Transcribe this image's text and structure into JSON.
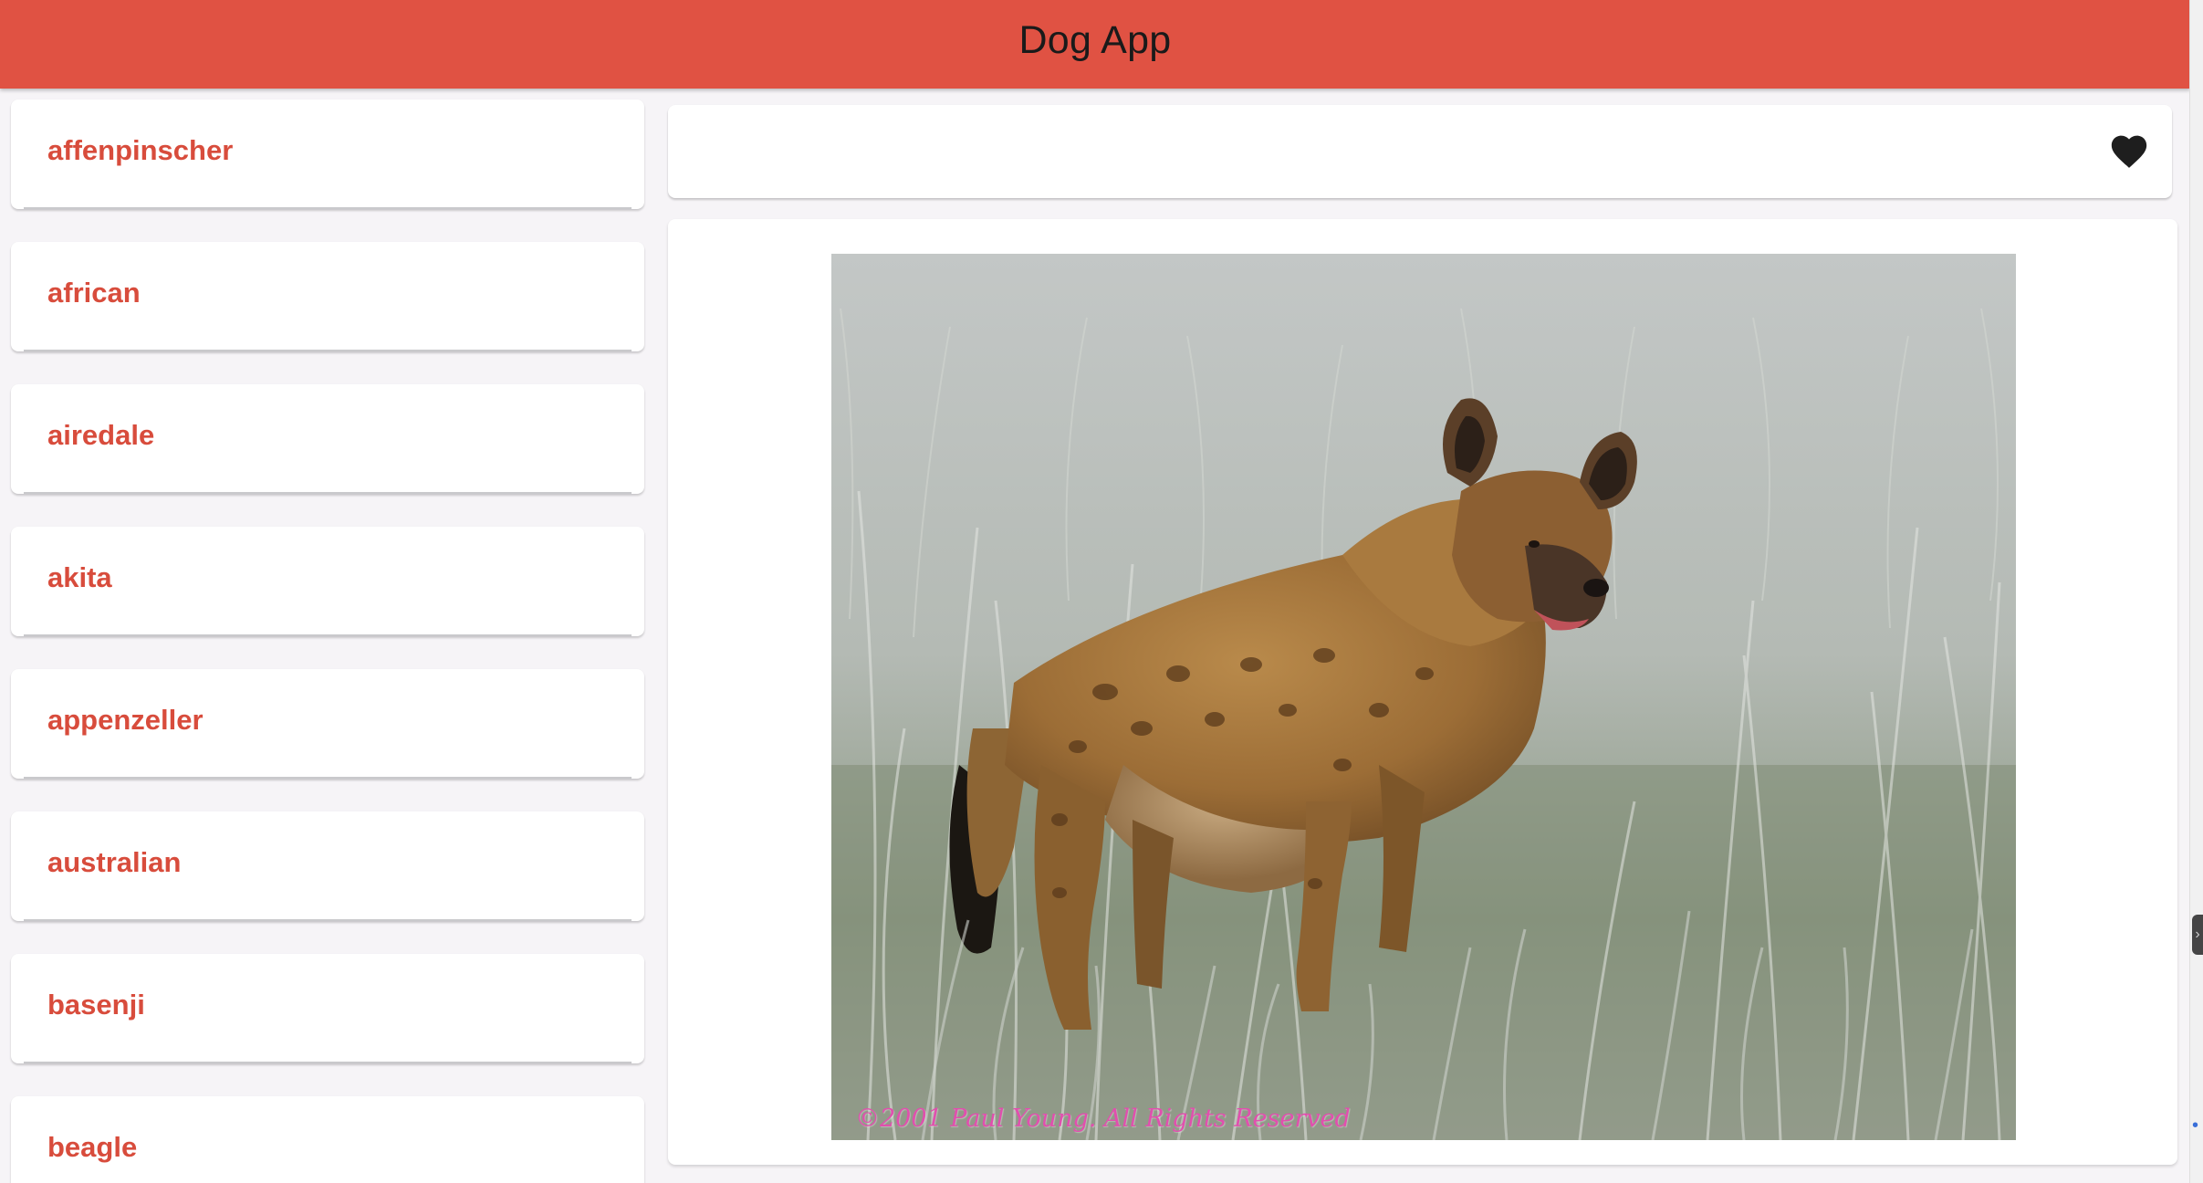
{
  "app_bar": {
    "title": "Dog App",
    "color": "#e05243"
  },
  "sidebar": {
    "accent_color": "#d84c3c",
    "breeds": [
      "affenpinscher",
      "african",
      "airedale",
      "akita",
      "appenzeller",
      "australian",
      "basenji",
      "beagle"
    ]
  },
  "toolbar": {
    "favorite_icon": "heart-icon"
  },
  "photo": {
    "subject": "spotted hyena standing in tall grass",
    "credit": "©2001 Paul Young. All Rights Reserved"
  }
}
